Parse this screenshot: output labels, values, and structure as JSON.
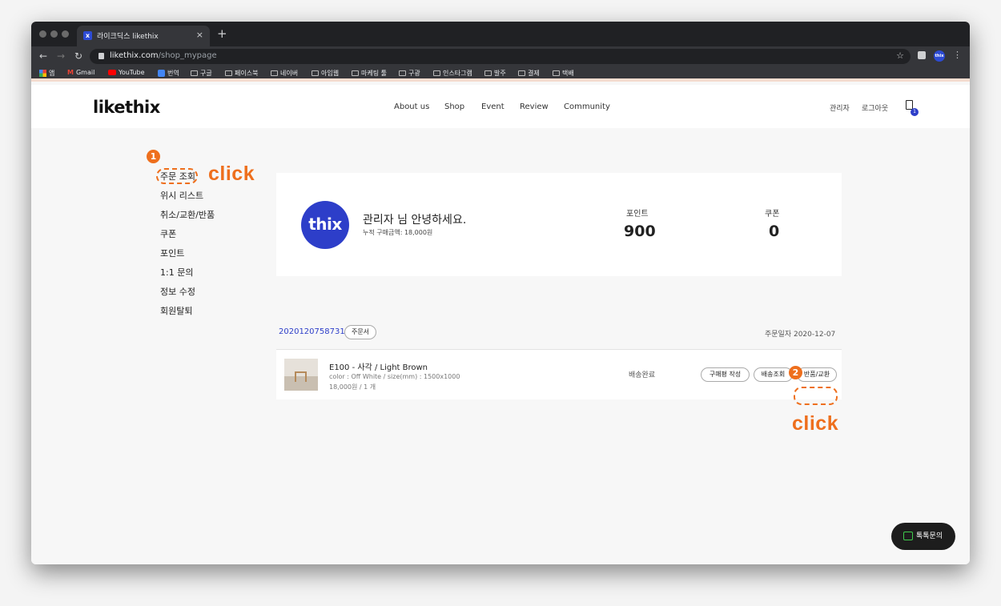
{
  "browser": {
    "tab_title": "라이크딕스 likethix",
    "tab_close": "×",
    "new_tab": "+",
    "url_domain": "likethix.com",
    "url_path": "/shop_mypage",
    "profile_label": "thix",
    "bookmarks": [
      "앱",
      "Gmail",
      "YouTube",
      "번역",
      "구글",
      "페이스북",
      "네이버",
      "아임웹",
      "마케팅 툴",
      "구광",
      "인스타그램",
      "발주",
      "결제",
      "택배"
    ]
  },
  "header": {
    "logo": "likethix",
    "menu": [
      "About us",
      "Shop",
      "Event",
      "Review",
      "Community"
    ],
    "admin": "관리자",
    "logout": "로그아웃",
    "cart_count": "1"
  },
  "sidebar": {
    "items": [
      "주문 조회",
      "위시 리스트",
      "취소/교환/반품",
      "쿠폰",
      "포인트",
      "1:1 문의",
      "정보 수정",
      "회원탈퇴"
    ]
  },
  "annotations": {
    "step1": "1",
    "step2": "2",
    "click1": "click",
    "click2": "click",
    "accent_color": "#ee6f1d"
  },
  "profile": {
    "avatar_text": "thix",
    "greeting": "관리자 님 안녕하세요.",
    "total_purchase": "누적 구매금액: 18,000원",
    "point_label": "포인트",
    "point_value": "900",
    "coupon_label": "쿠폰",
    "coupon_value": "0"
  },
  "order": {
    "number": "2020120758731",
    "receipt_btn": "주문서",
    "date": "주문일자 2020-12-07",
    "item": {
      "name": "E100 - 사각 / Light Brown",
      "options": "color : Off White / size(mm) : 1500x1000",
      "price": "18,000원 / 1 개",
      "status": "배송완료"
    },
    "actions": [
      "구매평 작성",
      "배송조회",
      "반품/교환"
    ]
  },
  "chat": {
    "label": "톡톡문의"
  }
}
